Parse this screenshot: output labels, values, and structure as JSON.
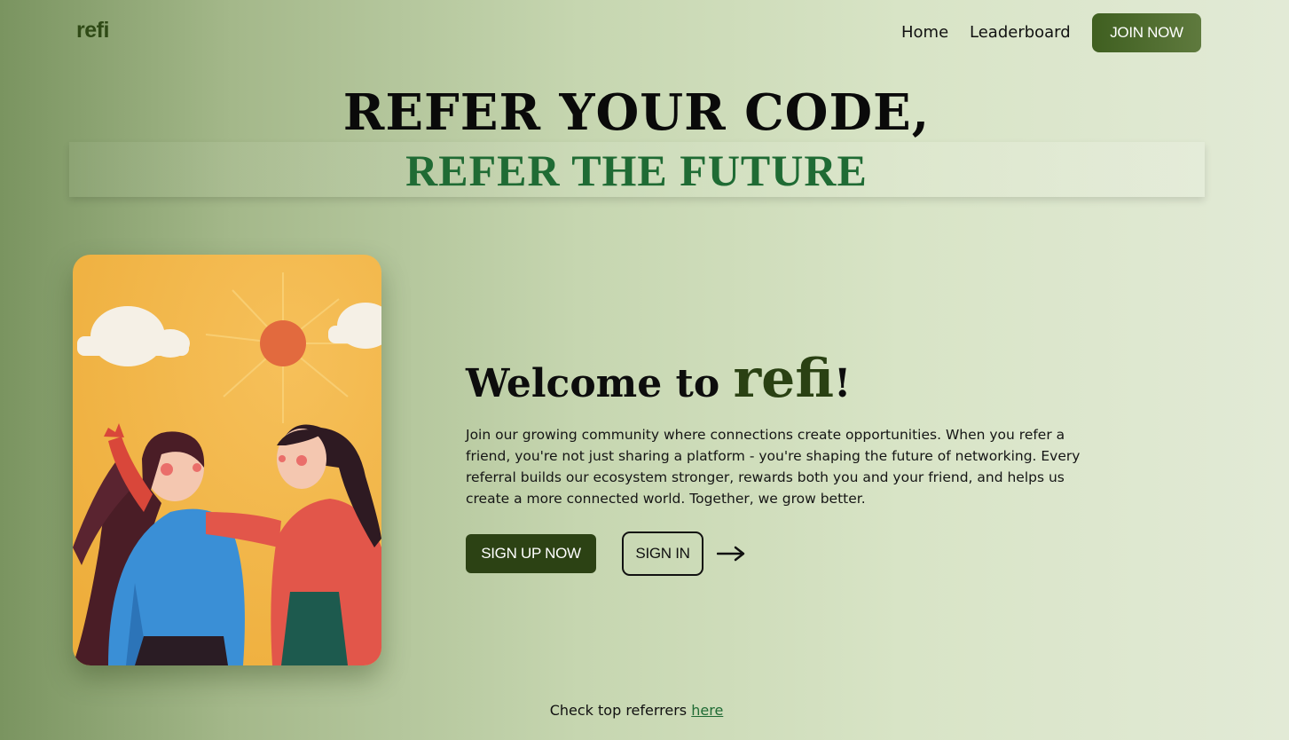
{
  "header": {
    "logo": "refi",
    "nav": [
      {
        "label": "Home"
      },
      {
        "label": "Leaderboard"
      }
    ],
    "join_label": "JOIN NOW"
  },
  "hero": {
    "title": "REFER YOUR CODE,",
    "subtitle": "REFER THE FUTURE"
  },
  "welcome": {
    "prefix": "Welcome to ",
    "brand": "refi",
    "suffix": "!",
    "description": "Join our growing community where connections create opportunities. When you refer a friend, you're not just sharing a platform - you're shaping the future of networking. Every referral builds our ecosystem stronger, rewards both you and your friend, and helps us create a more connected world. Together, we grow better.",
    "signup_label": "SIGN UP NOW",
    "signin_label": "SIGN IN"
  },
  "footer": {
    "text": "Check top referrers ",
    "link_label": "here"
  },
  "icons": {
    "arrow": "arrow-right-icon"
  },
  "colors": {
    "brand_dark_green": "#2c4214",
    "subtitle_green": "#1f6b34",
    "join_button": "#4f6d2f"
  }
}
